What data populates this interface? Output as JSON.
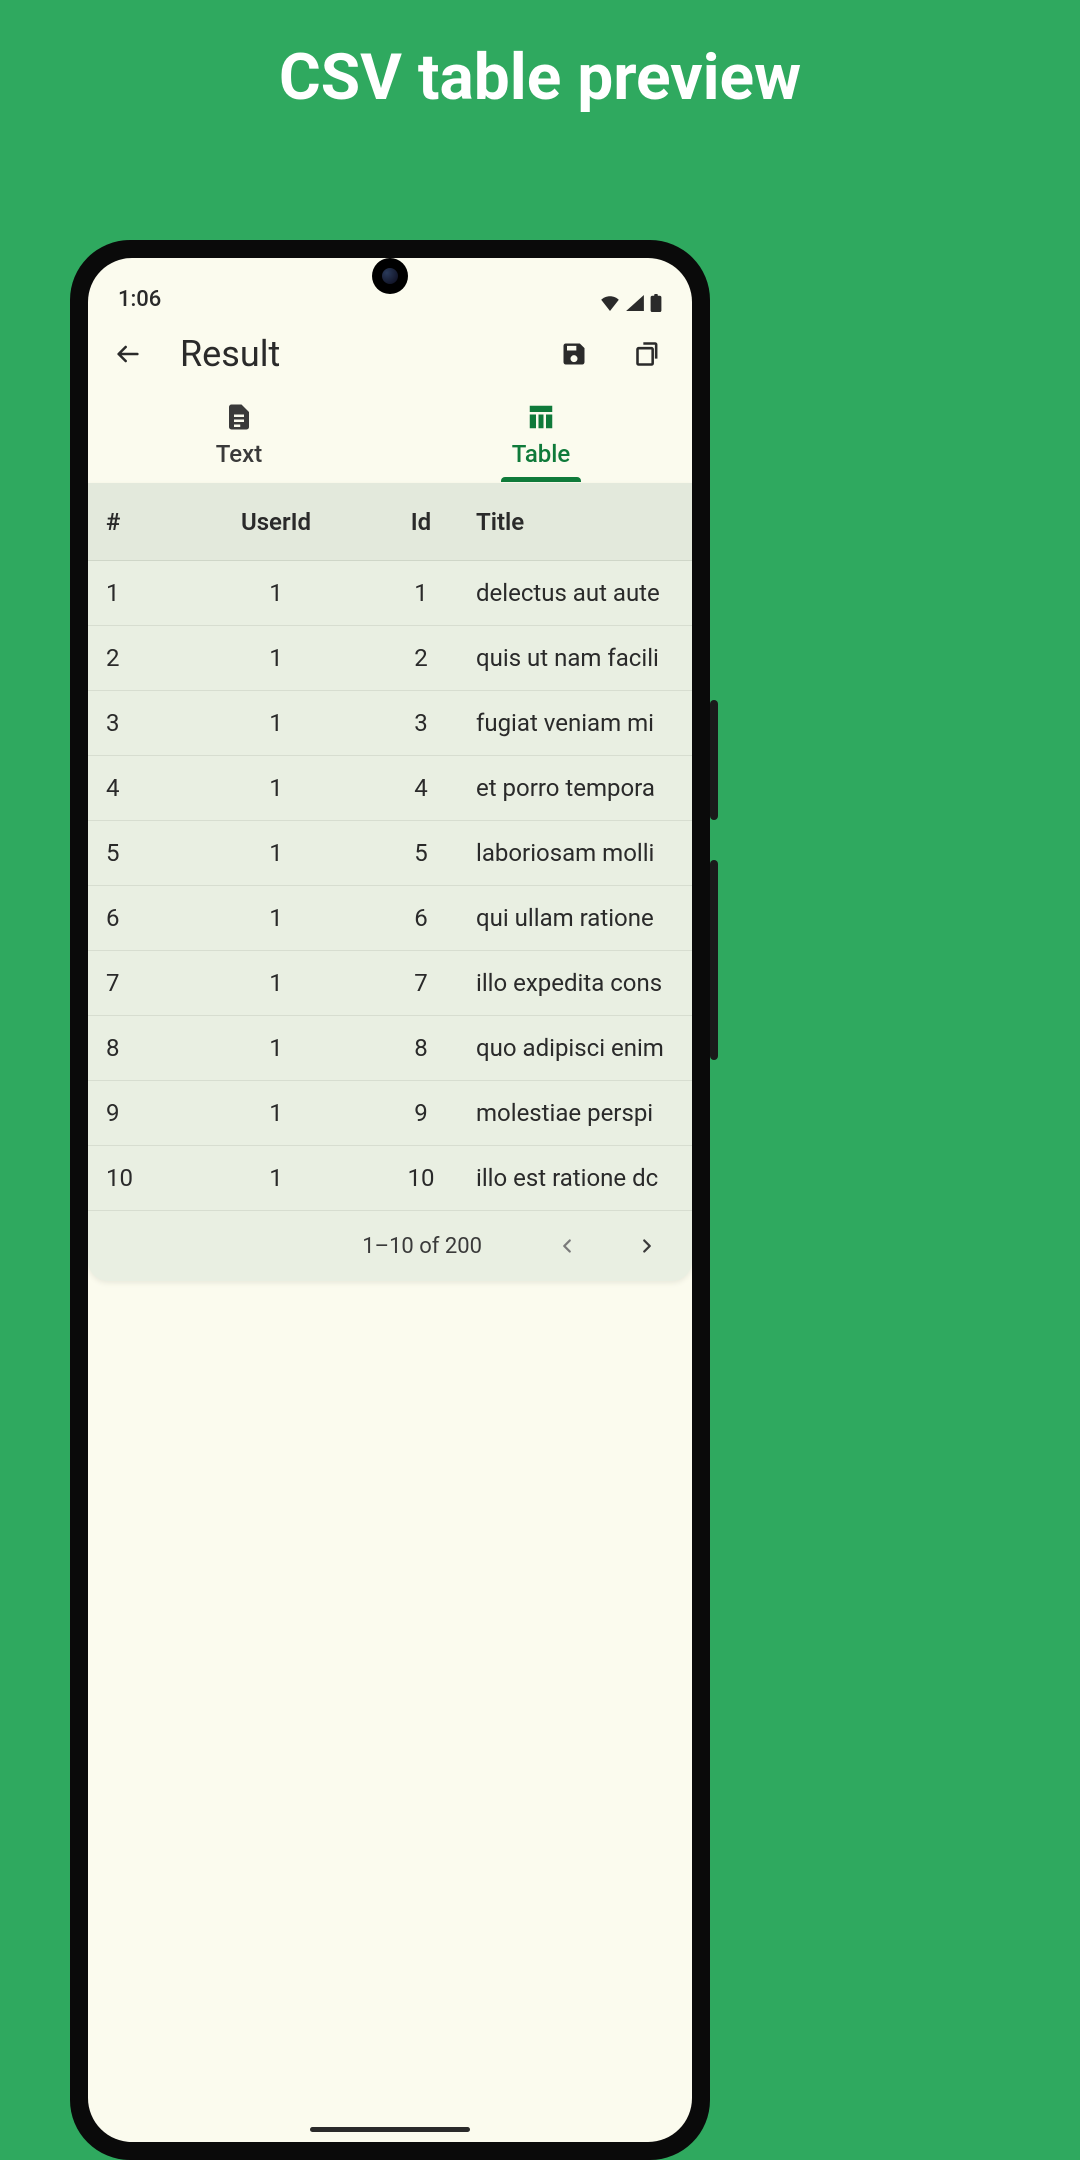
{
  "promo": {
    "title": "CSV table preview"
  },
  "status": {
    "time": "1:06"
  },
  "appbar": {
    "title": "Result"
  },
  "tabs": {
    "text_label": "Text",
    "table_label": "Table",
    "active": "table"
  },
  "table": {
    "headers": {
      "index": "#",
      "userId": "UserId",
      "id": "Id",
      "title": "Title"
    },
    "rows": [
      {
        "index": "1",
        "userId": "1",
        "id": "1",
        "title": "delectus aut aute"
      },
      {
        "index": "2",
        "userId": "1",
        "id": "2",
        "title": "quis ut nam facili"
      },
      {
        "index": "3",
        "userId": "1",
        "id": "3",
        "title": "fugiat veniam mi"
      },
      {
        "index": "4",
        "userId": "1",
        "id": "4",
        "title": "et porro tempora"
      },
      {
        "index": "5",
        "userId": "1",
        "id": "5",
        "title": "laboriosam molli"
      },
      {
        "index": "6",
        "userId": "1",
        "id": "6",
        "title": "qui ullam ratione"
      },
      {
        "index": "7",
        "userId": "1",
        "id": "7",
        "title": "illo expedita cons"
      },
      {
        "index": "8",
        "userId": "1",
        "id": "8",
        "title": "quo adipisci enim"
      },
      {
        "index": "9",
        "userId": "1",
        "id": "9",
        "title": "molestiae perspi"
      },
      {
        "index": "10",
        "userId": "1",
        "id": "10",
        "title": "illo est ratione dc"
      }
    ]
  },
  "pager": {
    "range": "1–10 of 200"
  }
}
